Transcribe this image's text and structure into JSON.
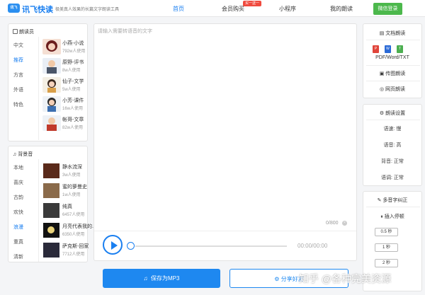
{
  "header": {
    "logo_text": "讯飞",
    "brand": "讯飞快读",
    "tagline": "极美真人效果的长篇文字朗读工具",
    "nav": [
      {
        "label": "首页"
      },
      {
        "label": "会员购买"
      },
      {
        "label": "小程序"
      },
      {
        "label": "我的朗读"
      }
    ],
    "nav_badge": "买一送一",
    "login_label": "微信登录"
  },
  "voice_panel": {
    "title": "朗读员",
    "categories": [
      "中文",
      "推荐",
      "方言",
      "外语",
      "特色"
    ],
    "voices": [
      {
        "name": "小燕-小说",
        "count": "792w人使用"
      },
      {
        "name": "原野-评书",
        "count": "8w人使用"
      },
      {
        "name": "仙子-文学",
        "count": "5w人使用"
      },
      {
        "name": "小芳-课件",
        "count": "16w人使用"
      },
      {
        "name": "帐哥-文章",
        "count": "82w人使用"
      }
    ]
  },
  "music_panel": {
    "title": "背景音",
    "categories": [
      "本地",
      "喜庆",
      "古韵",
      "欢快",
      "浪漫",
      "重真",
      "清新"
    ],
    "tracks": [
      {
        "name": "静水流深",
        "count": "3w人使用"
      },
      {
        "name": "蜜的萝曼史",
        "count": "1w人使用"
      },
      {
        "name": "纯真",
        "count": "6457人使用"
      },
      {
        "name": "月亮代表我的...",
        "count": "6350人使用"
      },
      {
        "name": "萨克斯-回家",
        "count": "7712人使用"
      }
    ]
  },
  "editor": {
    "placeholder": "请输入需要转语音的文字",
    "char_count": "0/800",
    "time": "00:00/00:00"
  },
  "buttons": {
    "save": "保存为MP3",
    "share": "分享好友"
  },
  "doc_panel": {
    "title": "文档朗读",
    "formats": "PDF/Word/TXT",
    "image_read": "传图朗读",
    "web_read": "网页朗读"
  },
  "settings_panel": {
    "title": "朗读设置",
    "rows": [
      {
        "label": "语速: 慢"
      },
      {
        "label": "语音: 高"
      },
      {
        "label": "背音: 正常"
      },
      {
        "label": "语调: 正常"
      }
    ]
  },
  "multi_panel": {
    "title": "多音字纠正",
    "pause_title": "插入停顿",
    "pauses": [
      "0.5 秒",
      "1 秒",
      "2 秒"
    ]
  },
  "watermark": "知乎 @各种完美资源",
  "colors": {
    "accent": "#1a7ff0",
    "login": "#4cb84c",
    "badge": "#f04a3e"
  }
}
